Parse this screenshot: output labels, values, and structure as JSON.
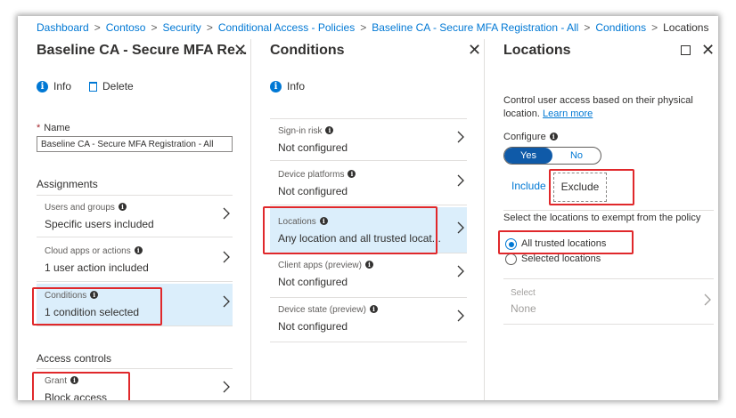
{
  "breadcrumb": [
    "Dashboard",
    "Contoso",
    "Security",
    "Conditional Access - Policies",
    "Baseline CA - Secure MFA Registration - All",
    "Conditions",
    "Locations"
  ],
  "policy_blade": {
    "title": "Baseline CA - Secure MFA Re...",
    "info_label": "Info",
    "delete_label": "Delete",
    "name_label": "Name",
    "name_value": "Baseline CA - Secure MFA Registration - All",
    "assignments_heading": "Assignments",
    "rows": [
      {
        "label": "Users and groups",
        "value": "Specific users included"
      },
      {
        "label": "Cloud apps or actions",
        "value": "1 user action included"
      },
      {
        "label": "Conditions",
        "value": "1 condition selected"
      }
    ],
    "access_controls_heading": "Access controls",
    "grant": {
      "label": "Grant",
      "value": "Block access"
    }
  },
  "conditions_blade": {
    "title": "Conditions",
    "info_label": "Info",
    "rows": [
      {
        "label": "Sign-in risk",
        "value": "Not configured"
      },
      {
        "label": "Device platforms",
        "value": "Not configured"
      },
      {
        "label": "Locations",
        "value": "Any location and all trusted locat..."
      },
      {
        "label": "Client apps (preview)",
        "value": "Not configured"
      },
      {
        "label": "Device state (preview)",
        "value": "Not configured"
      }
    ]
  },
  "locations_blade": {
    "title": "Locations",
    "description": "Control user access based on their physical location.",
    "learn_more": "Learn more",
    "configure_label": "Configure",
    "toggle_yes": "Yes",
    "toggle_no": "No",
    "tab_include": "Include",
    "tab_exclude": "Exclude",
    "exempt_prompt": "Select the locations to exempt from the policy",
    "radio_all": "All trusted locations",
    "radio_selected": "Selected locations",
    "select_label": "Select",
    "select_value": "None"
  },
  "colors": {
    "accent": "#0078d4",
    "selected_row": "#dbeefb",
    "highlight": "#e0282b",
    "toggle_on": "#0f5aa8"
  }
}
